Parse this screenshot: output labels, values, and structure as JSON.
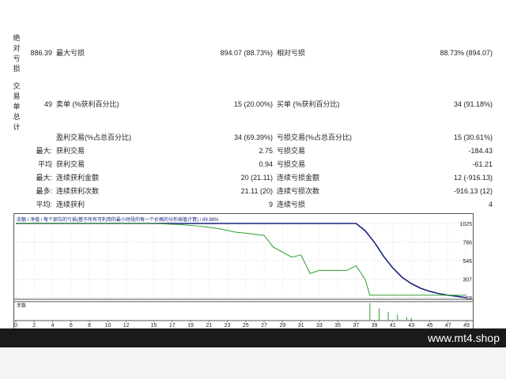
{
  "stats": {
    "absolute_dd_label": "绝对亏损",
    "absolute_dd_value": "886.39",
    "max_dd_label": "最大亏损",
    "max_dd_value": "894.07 (88.73%)",
    "relative_dd_label": "相对亏损",
    "relative_dd_value": "88.73% (894.07)",
    "total_trades_label": "交易单总计",
    "total_trades_value": "49",
    "short_label": "卖单 (%获利百分比)",
    "short_value": "15 (20.00%)",
    "long_label": "买单 (%获利百分比)",
    "long_value": "34 (91.18%)",
    "profit_trades_label": "盈利交易(%占总百分比)",
    "profit_trades_value": "34 (69.39%)",
    "loss_trades_label": "亏损交易(%占总百分比)",
    "loss_trades_value": "15 (30.61%)",
    "rows": [
      {
        "prefix": "最大:",
        "l_label": "获利交易",
        "l_value": "2.75",
        "r_label": "亏损交易",
        "r_value": "-184.43"
      },
      {
        "prefix": "平均",
        "l_label": "获利交易",
        "l_value": "0.94",
        "r_label": "亏损交易",
        "r_value": "-61.21"
      },
      {
        "prefix": "最大:",
        "l_label": "连续获利金额",
        "l_value": "20 (21.11)",
        "r_label": "连续亏损金额",
        "r_value": "12 (-916.13)"
      },
      {
        "prefix": "最多:",
        "l_label": "连续获利次数",
        "l_value": "21.11 (20)",
        "r_label": "连续亏损次数",
        "r_value": "-916.13 (12)"
      },
      {
        "prefix": "平均:",
        "l_label": "连续获利",
        "l_value": "9",
        "r_label": "连续亏损",
        "r_value": "4"
      }
    ]
  },
  "chart_data": {
    "type": "line",
    "legend_text": "余额 / 净值 / 每个部位的亏损(基于所有可利用的最小时段的每一个价格的分形插值计算) / 89.98%",
    "legend_balance": "余额",
    "legend_equity": "净值",
    "legend_rest": "每个部位分形插值计算 / 89.98%",
    "y_ticks": [
      "1025",
      "786",
      "546",
      "307",
      "68"
    ],
    "ylim": [
      68,
      1025
    ],
    "x_ticks": [
      "0",
      "2",
      "4",
      "6",
      "8",
      "10",
      "12",
      "15",
      "17",
      "19",
      "21",
      "23",
      "25",
      "27",
      "29",
      "31",
      "33",
      "35",
      "37",
      "39",
      "41",
      "43",
      "45",
      "47",
      "49"
    ],
    "volume_label": "手数",
    "series": [
      {
        "name": "余额",
        "color": "#1a237e",
        "x": [
          0,
          37,
          38,
          39,
          40,
          41,
          42,
          43,
          44,
          45,
          46,
          47,
          48,
          49
        ],
        "values": [
          1025,
          1025,
          930,
          780,
          600,
          450,
          330,
          250,
          190,
          150,
          120,
          100,
          85,
          68
        ]
      },
      {
        "name": "净值",
        "color": "#2e9d2e",
        "x": [
          0,
          15,
          18,
          20,
          22,
          24,
          25,
          27,
          28,
          30,
          31,
          32,
          33,
          34,
          36,
          37,
          38,
          38.5,
          49
        ],
        "values": [
          1025,
          1025,
          1010,
          990,
          960,
          910,
          900,
          870,
          720,
          590,
          620,
          380,
          420,
          420,
          420,
          480,
          300,
          100,
          100
        ]
      }
    ],
    "volume_bars": {
      "x": [
        38.5,
        39.5,
        40.5,
        41.5,
        42.5,
        43
      ],
      "values": [
        1.0,
        0.7,
        0.5,
        0.35,
        0.2,
        0.15
      ]
    }
  },
  "footer": {
    "watermark": "www.mt4.shop"
  }
}
